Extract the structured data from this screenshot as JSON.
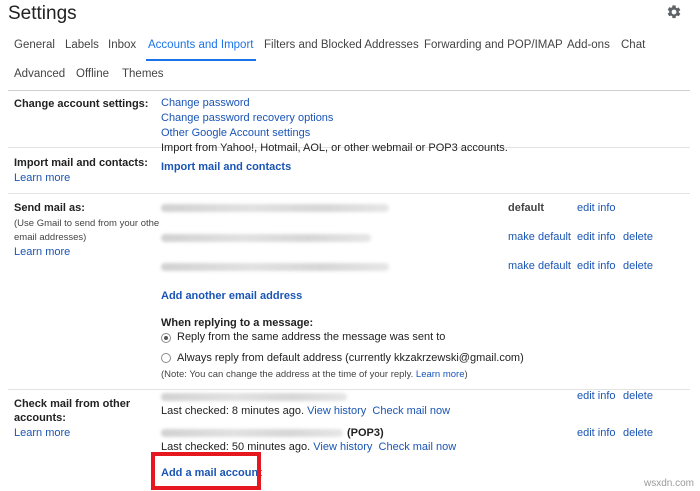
{
  "page": {
    "title": "Settings"
  },
  "tabs": [
    {
      "label": "General",
      "active": false
    },
    {
      "label": "Labels",
      "active": false
    },
    {
      "label": "Inbox",
      "active": false
    },
    {
      "label": "Accounts and Import",
      "active": true
    },
    {
      "label": "Filters and Blocked Addresses",
      "active": false
    },
    {
      "label": "Forwarding and POP/IMAP",
      "active": false
    },
    {
      "label": "Add-ons",
      "active": false
    },
    {
      "label": "Chat",
      "active": false
    },
    {
      "label": "Advanced",
      "active": false
    },
    {
      "label": "Offline",
      "active": false
    },
    {
      "label": "Themes",
      "active": false
    }
  ],
  "change_account": {
    "label": "Change account settings:",
    "links": [
      "Change password",
      "Change password recovery options",
      "Other Google Account settings"
    ]
  },
  "import_mail": {
    "label": "Import mail and contacts:",
    "learn_more": "Learn more",
    "description": "Import from Yahoo!, Hotmail, AOL, or other webmail or POP3 accounts.",
    "action": "Import mail and contacts"
  },
  "send_mail": {
    "label": "Send mail as:",
    "note_line1": "(Use Gmail to send from your othe",
    "note_line2": "email addresses)",
    "learn_more": "Learn more",
    "rows": [
      {
        "default": "default",
        "make_default": "",
        "edit": "edit info",
        "delete": ""
      },
      {
        "default": "",
        "make_default": "make default",
        "edit": "edit info",
        "delete": "delete"
      },
      {
        "default": "",
        "make_default": "make default",
        "edit": "edit info",
        "delete": "delete"
      }
    ],
    "add_address": "Add another email address",
    "reply_heading": "When replying to a message:",
    "reply_option_1": "Reply from the same address the message was sent to",
    "reply_option_2": "Always reply from default address (currently kkzakrzewski@gmail.com)",
    "reply_note_prefix": "(Note: You can change the address at the time of your reply. ",
    "reply_note_link": "Learn more",
    "reply_note_suffix": ")"
  },
  "check_mail": {
    "label_line1": "Check mail from other",
    "label_line2": "accounts:",
    "learn_more": "Learn more",
    "accounts": [
      {
        "suffix": "",
        "last_checked": "Last checked: 8 minutes ago.",
        "view_history": "View history",
        "check_now": "Check mail now",
        "edit": "edit info",
        "delete": "delete"
      },
      {
        "suffix": "(POP3)",
        "last_checked": "Last checked: 50 minutes ago.",
        "view_history": "View history",
        "check_now": "Check mail now",
        "edit": "edit info",
        "delete": "delete"
      }
    ],
    "add_account": "Add a mail account"
  },
  "colors": {
    "accent": "#1a73e8",
    "link": "#1a55b5",
    "highlight": "#e5181f"
  },
  "icons": {
    "settings": "gear-icon"
  },
  "watermark": "wsxdn.com"
}
